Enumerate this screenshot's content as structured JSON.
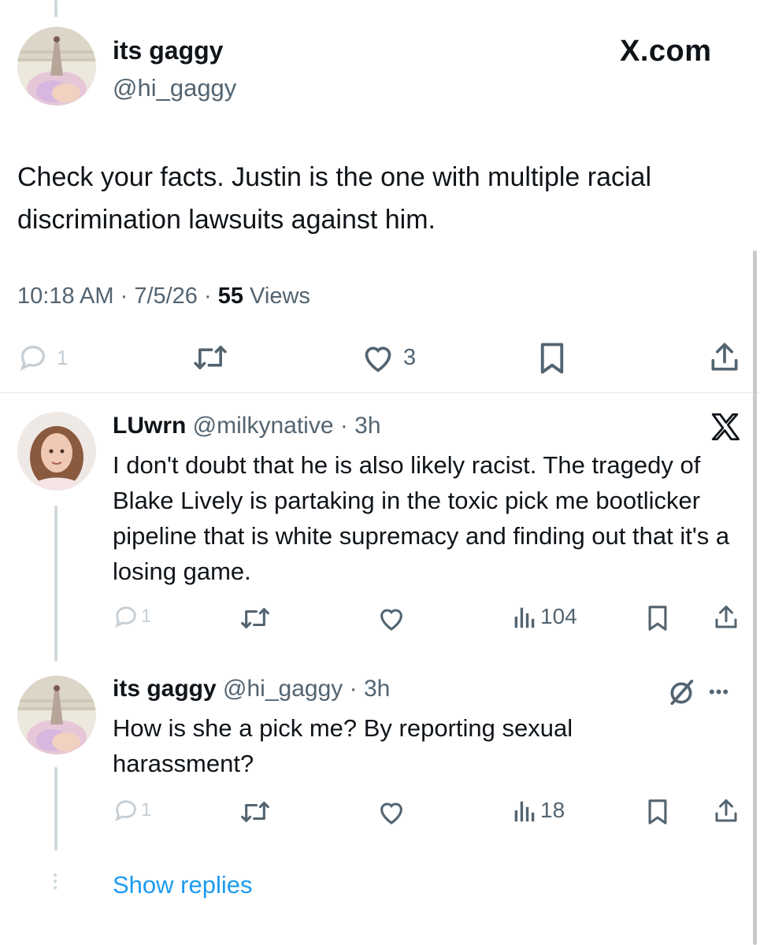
{
  "main_tweet": {
    "display_name": "its gaggy",
    "handle": "@hi_gaggy",
    "brand": "X.com",
    "text": "Check your facts. Justin is the one with multiple racial discrimination lawsuits against him.",
    "time": "10:18 AM",
    "sep1": " · ",
    "date": "7/5/26",
    "sep2": " · ",
    "views_count": "55",
    "views_label": " Views",
    "actions": {
      "replies": "1",
      "likes": "3"
    }
  },
  "replies": [
    {
      "display_name": "LUwrn",
      "handle": "@milkynative",
      "time": " · 3h",
      "text": "I don't doubt that he is also likely racist. The tragedy of Blake Lively is partaking in the toxic pick me bootlicker pipeline that is white supremacy and finding out that it's a losing game.",
      "reply_count": "1",
      "views": "104"
    },
    {
      "display_name": "its gaggy",
      "handle": "@hi_gaggy",
      "time": " · 3h",
      "text": "How is she a pick me? By reporting sexual harassment?",
      "reply_count": "1",
      "views": "18"
    }
  ],
  "show_replies": "Show replies",
  "icons": [
    "reply-icon",
    "retweet-icon",
    "like-icon",
    "bookmark-icon",
    "share-icon",
    "views-icon",
    "x-logo-icon",
    "grok-slash-icon",
    "more-icon"
  ]
}
